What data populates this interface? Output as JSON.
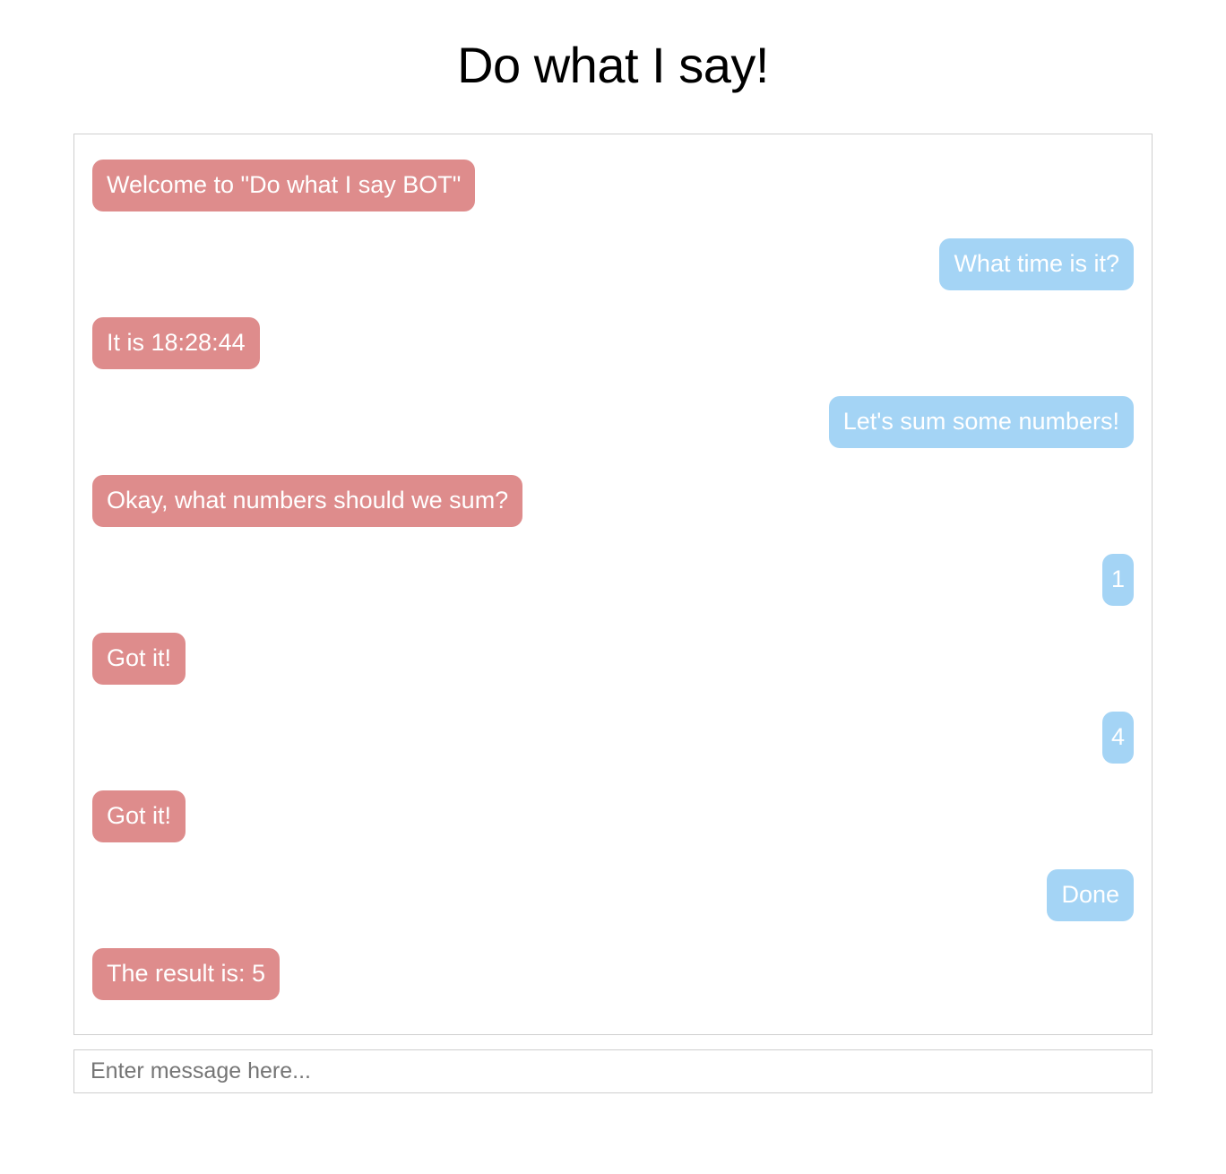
{
  "page": {
    "title": "Do what I say!"
  },
  "colors": {
    "bot_bubble": "#de8c8c",
    "user_bubble": "#a4d4f5",
    "bubble_text": "#ffffff",
    "border": "#cfcfcf",
    "placeholder_text": "#757575",
    "background": "#ffffff"
  },
  "chat": {
    "messages": [
      {
        "sender": "bot",
        "text": "Welcome to \"Do what I say BOT\""
      },
      {
        "sender": "user",
        "text": "What time is it?"
      },
      {
        "sender": "bot",
        "text": "It is 18:28:44"
      },
      {
        "sender": "user",
        "text": "Let's sum some numbers!"
      },
      {
        "sender": "bot",
        "text": "Okay, what numbers should we sum?"
      },
      {
        "sender": "user",
        "text": "1"
      },
      {
        "sender": "bot",
        "text": "Got it!"
      },
      {
        "sender": "user",
        "text": "4"
      },
      {
        "sender": "bot",
        "text": "Got it!"
      },
      {
        "sender": "user",
        "text": "Done"
      },
      {
        "sender": "bot",
        "text": "The result is: 5"
      }
    ]
  },
  "composer": {
    "placeholder": "Enter message here...",
    "value": ""
  }
}
